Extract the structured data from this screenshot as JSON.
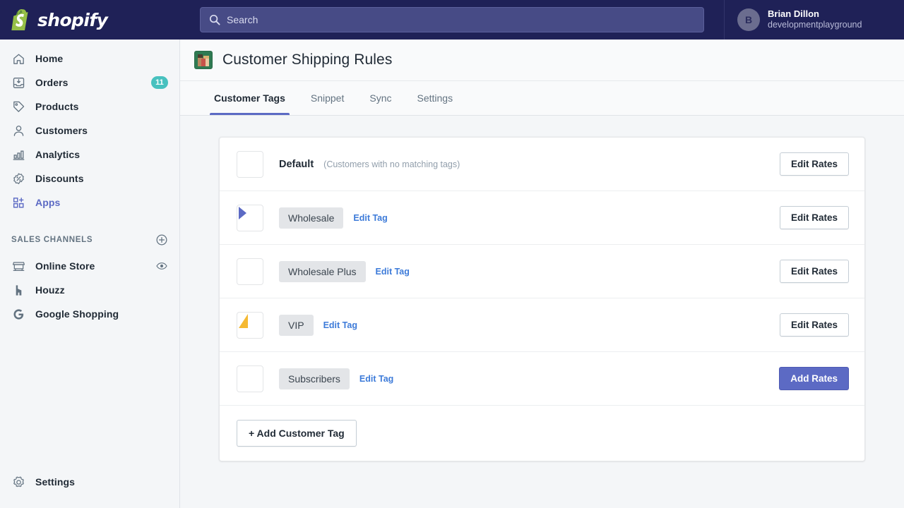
{
  "topbar": {
    "brand_name": "shopify",
    "brand_icon": "shopify-bag-icon",
    "search_placeholder": "Search",
    "search_value": "",
    "search_icon": "search-icon",
    "user": {
      "avatar_initial": "B",
      "name": "Brian Dillon",
      "shop": "developmentplayground"
    },
    "colors": {
      "background": "#1f2157",
      "search_field": "#474b86"
    }
  },
  "sidebar": {
    "items": [
      {
        "label": "Home",
        "icon": "home-icon",
        "badge": "",
        "active": false
      },
      {
        "label": "Orders",
        "icon": "orders-inbox-icon",
        "badge": "11",
        "active": false
      },
      {
        "label": "Products",
        "icon": "product-tag-icon",
        "badge": "",
        "active": false
      },
      {
        "label": "Customers",
        "icon": "customer-person-icon",
        "badge": "",
        "active": false
      },
      {
        "label": "Analytics",
        "icon": "analytics-bar-chart-icon",
        "badge": "",
        "active": false
      },
      {
        "label": "Discounts",
        "icon": "discount-percent-icon",
        "badge": "",
        "active": false
      },
      {
        "label": "Apps",
        "icon": "apps-grid-plus-icon",
        "badge": "",
        "active": true
      }
    ],
    "section": {
      "title": "SALES CHANNELS",
      "add_icon": "plus-circle-icon",
      "channels": [
        {
          "label": "Online Store",
          "icon": "storefront-icon",
          "trailing_icon": "eye-icon"
        },
        {
          "label": "Houzz",
          "icon": "houzz-icon",
          "trailing_icon": ""
        },
        {
          "label": "Google Shopping",
          "icon": "google-g-icon",
          "trailing_icon": ""
        }
      ]
    },
    "footer": {
      "label": "Settings",
      "icon": "gear-icon"
    },
    "colors": {
      "background": "#f4f6f8",
      "badge": "#47c1bf",
      "active_text": "#5c6ac4"
    }
  },
  "page": {
    "app_icon": "customer-shipping-rules-app-icon",
    "title": "Customer Shipping Rules",
    "tabs": [
      {
        "label": "Customer Tags",
        "active": true
      },
      {
        "label": "Snippet",
        "active": false
      },
      {
        "label": "Sync",
        "active": false
      },
      {
        "label": "Settings",
        "active": false
      }
    ],
    "accent_color": "#5c6ac4"
  },
  "rules": {
    "rows": [
      {
        "type": "default",
        "thumb_icon": "green-abstract-thumbnail",
        "thumb_colors": {
          "left": "#4caf6d",
          "right": "#1e5b3a",
          "accent": "#8bc34a"
        },
        "name": "Default",
        "note": "(Customers with no matching tags)",
        "tag": "",
        "edit_tag_label": "",
        "action_label": "Edit Rates",
        "action_primary": false
      },
      {
        "type": "tag",
        "thumb_icon": "yellow-abstract-thumbnail",
        "thumb_colors": {
          "left": "#f5b932",
          "right": "#fbe7b6",
          "accent": "#5c6ac4"
        },
        "name": "",
        "note": "",
        "tag": "Wholesale",
        "edit_tag_label": "Edit Tag",
        "action_label": "Edit Rates",
        "action_primary": false
      },
      {
        "type": "tag",
        "thumb_icon": "blue-yellow-abstract-thumbnail",
        "thumb_colors": {
          "left": "#4450b8",
          "right": "#f5b932",
          "accent": "#6b76cc"
        },
        "name": "",
        "note": "",
        "tag": "Wholesale Plus",
        "edit_tag_label": "Edit Tag",
        "action_label": "Edit Rates",
        "action_primary": false
      },
      {
        "type": "tag",
        "thumb_icon": "indigo-night-abstract-thumbnail",
        "thumb_colors": {
          "left": "#5c6ac4",
          "right": "#1f2157",
          "accent": "#f5b932"
        },
        "name": "",
        "note": "",
        "tag": "VIP",
        "edit_tag_label": "Edit Tag",
        "action_label": "Edit Rates",
        "action_primary": false
      },
      {
        "type": "tag",
        "thumb_icon": "teal-sail-abstract-thumbnail",
        "thumb_colors": {
          "left": "#47c1bf",
          "right": "#4450b8",
          "accent": "#ffffff"
        },
        "name": "",
        "note": "",
        "tag": "Subscribers",
        "edit_tag_label": "Edit Tag",
        "action_label": "Add Rates",
        "action_primary": true
      }
    ],
    "add_tag_label": "+ Add Customer Tag"
  }
}
